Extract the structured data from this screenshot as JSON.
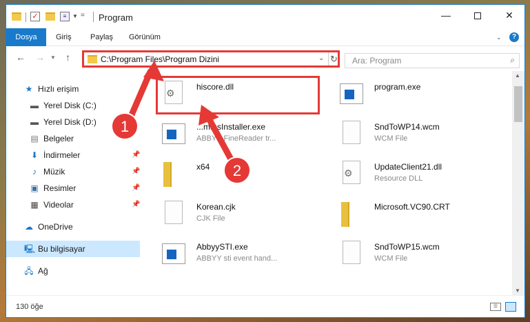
{
  "window": {
    "title": "Program",
    "minimize": "—",
    "close": "✕"
  },
  "ribbon": {
    "tabs": [
      "Dosya",
      "Giriş",
      "Paylaş",
      "Görünüm"
    ],
    "help": "?"
  },
  "address": {
    "path": "C:\\Program Files\\Program Dizini",
    "search_placeholder": "Ara: Program"
  },
  "sidebar": {
    "items": [
      {
        "label": "Hızlı erişim",
        "icon": "star-icon"
      },
      {
        "label": "Yerel Disk (C:)",
        "icon": "drive-icon"
      },
      {
        "label": "Yerel Disk (D:)",
        "icon": "drive-icon"
      },
      {
        "label": "Belgeler",
        "icon": "documents-icon"
      },
      {
        "label": "İndirmeler",
        "icon": "download-icon"
      },
      {
        "label": "Müzik",
        "icon": "music-icon"
      },
      {
        "label": "Resimler",
        "icon": "pictures-icon"
      },
      {
        "label": "Videolar",
        "icon": "video-icon"
      },
      {
        "label": "OneDrive",
        "icon": "cloud-icon"
      },
      {
        "label": "Bu bilgisayar",
        "icon": "computer-icon"
      },
      {
        "label": "Ağ",
        "icon": "network-icon"
      }
    ]
  },
  "files": [
    {
      "name": "hiscore.dll",
      "type": "",
      "icon": "dll-icon"
    },
    {
      "name": "program.exe",
      "type": "",
      "icon": "exe-icon"
    },
    {
      "name": "...mmsInstaller.exe",
      "type": "ABBYY FineReader tr...",
      "icon": "exe-icon"
    },
    {
      "name": "SndToWP14.wcm",
      "type": "WCM File",
      "icon": "file-icon"
    },
    {
      "name": "x64",
      "type": "",
      "icon": "folder-icon"
    },
    {
      "name": "UpdateClient21.dll",
      "type": "Resource DLL",
      "icon": "dll-icon"
    },
    {
      "name": "Korean.cjk",
      "type": "CJK File",
      "icon": "file-icon"
    },
    {
      "name": "Microsoft.VC90.CRT",
      "type": "",
      "icon": "folder-icon"
    },
    {
      "name": "AbbyySTI.exe",
      "type": "ABBYY sti event hand...",
      "icon": "exe-icon"
    },
    {
      "name": "SndToWP15.wcm",
      "type": "WCM File",
      "icon": "file-icon"
    }
  ],
  "status": {
    "count": "130 öğe"
  },
  "annotations": {
    "badge1": "1",
    "badge2": "2",
    "color": "#e53935"
  }
}
